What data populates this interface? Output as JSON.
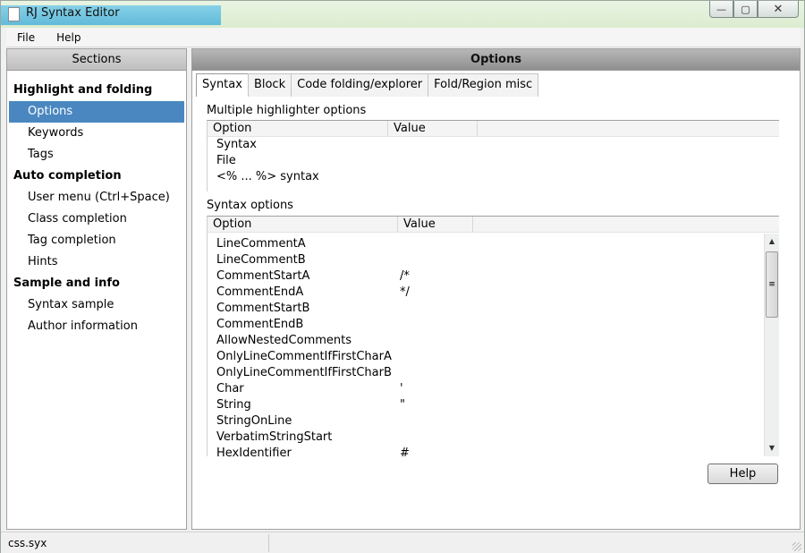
{
  "window": {
    "title": "RJ Syntax Editor",
    "controls": {
      "minimize": "—",
      "maximize": "▢",
      "close": "✕"
    }
  },
  "menu": {
    "file": "File",
    "help": "Help"
  },
  "sections": {
    "header": "Sections",
    "groups": [
      {
        "label": "Highlight and folding",
        "items": [
          "Options",
          "Keywords",
          "Tags"
        ]
      },
      {
        "label": "Auto completion",
        "items": [
          "User menu (Ctrl+Space)",
          "Class completion",
          "Tag completion",
          "Hints"
        ]
      },
      {
        "label": "Sample and info",
        "items": [
          "Syntax sample",
          "Author information"
        ]
      }
    ],
    "selected": "Options"
  },
  "options": {
    "header": "Options",
    "tabs": [
      "Syntax",
      "Block",
      "Code folding/explorer",
      "Fold/Region misc"
    ],
    "active_tab": "Syntax",
    "multi": {
      "label": "Multiple highlighter options",
      "col_option": "Option",
      "col_value": "Value",
      "rows": [
        {
          "option": "Syntax",
          "value": ""
        },
        {
          "option": "File",
          "value": ""
        },
        {
          "option": "<% ... %> syntax",
          "value": ""
        }
      ]
    },
    "syntax": {
      "label": "Syntax options",
      "col_option": "Option",
      "col_value": "Value",
      "rows": [
        {
          "option": "LineCommentA",
          "value": ""
        },
        {
          "option": "LineCommentB",
          "value": ""
        },
        {
          "option": "CommentStartA",
          "value": "/*"
        },
        {
          "option": "CommentEndA",
          "value": "*/"
        },
        {
          "option": "CommentStartB",
          "value": ""
        },
        {
          "option": "CommentEndB",
          "value": ""
        },
        {
          "option": "AllowNestedComments",
          "value": ""
        },
        {
          "option": "OnlyLineCommentIfFirstCharA",
          "value": ""
        },
        {
          "option": "OnlyLineCommentIfFirstCharB",
          "value": ""
        },
        {
          "option": "Char",
          "value": "'"
        },
        {
          "option": "String",
          "value": "\""
        },
        {
          "option": "StringOnLine",
          "value": ""
        },
        {
          "option": "VerbatimStringStart",
          "value": ""
        },
        {
          "option": "HexIdentifier",
          "value": "#"
        }
      ]
    },
    "help_button": "Help"
  },
  "status": {
    "file": "css.syx"
  }
}
